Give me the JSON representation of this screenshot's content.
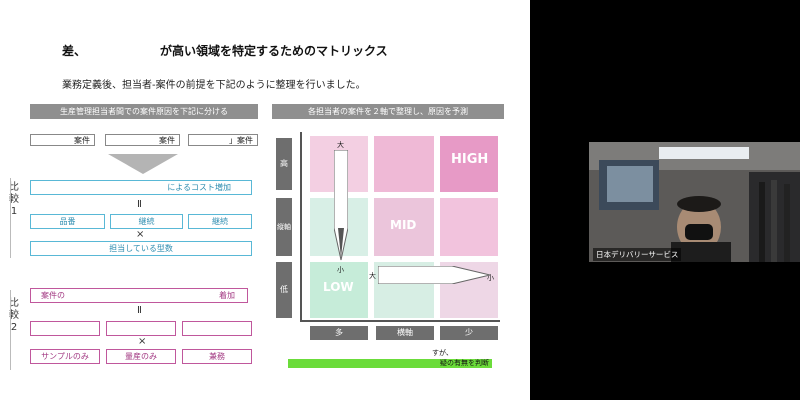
{
  "slide": {
    "title_left": "差、",
    "title_right": "が高い領域を特定するためのマトリックス",
    "subtitle": "業務定義後、担当者-案件の前提を下記のように整理を行いました。",
    "left_header": "生産管理担当者間での案件原因を下記に分ける",
    "right_header": "各担当者の案件を２軸で整理し、原因を予測",
    "top_boxes": [
      "案件",
      "案件",
      "」案件"
    ],
    "compare1": {
      "label": "比較1",
      "row1": "によるコスト増加",
      "eq": "Ⅱ",
      "row2": [
        "品番",
        "継続",
        "継続"
      ],
      "times": "×",
      "row3": "担当している型数"
    },
    "compare2": {
      "label": "比較2",
      "row1_left": "案件の",
      "row1_right": "着加",
      "eq": "Ⅱ",
      "row2": [
        "",
        "",
        ""
      ],
      "times": "×",
      "row3": [
        "サンプルのみ",
        "量産のみ",
        "兼務"
      ]
    },
    "matrix": {
      "y_labels": [
        "高",
        "縦軸",
        "低"
      ],
      "x_labels": [
        "多",
        "横軸",
        "少"
      ],
      "high": "HIGH",
      "mid": "MID",
      "low": "LOW",
      "v_big": "大",
      "v_small": "小",
      "h_big": "大",
      "h_small": "小"
    },
    "footer_note": "すが、",
    "footer_green": "疑の有無を判断"
  },
  "video": {
    "participant_name": "日本デリバリーサービス"
  },
  "colors": {
    "blue": "#59b8d6",
    "pink": "#c0579c",
    "green": "#6bdc3a"
  }
}
